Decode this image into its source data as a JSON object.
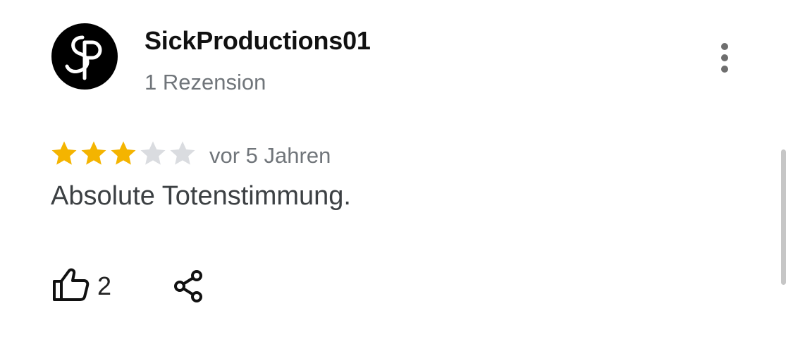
{
  "review": {
    "author": {
      "name": "SickProductions01",
      "meta": "1 Rezension",
      "avatar_icon": "sp-monogram-logo"
    },
    "rating": {
      "value": 3,
      "max": 5,
      "filled_color": "#F4B400",
      "empty_color": "#DADCE0"
    },
    "date": "vor 5 Jahren",
    "text": "Absolute Totenstimmung.",
    "actions": {
      "like_icon": "thumbs-up-icon",
      "like_count": "2",
      "share_icon": "share-icon",
      "more_icon": "more-vertical-icon"
    }
  }
}
